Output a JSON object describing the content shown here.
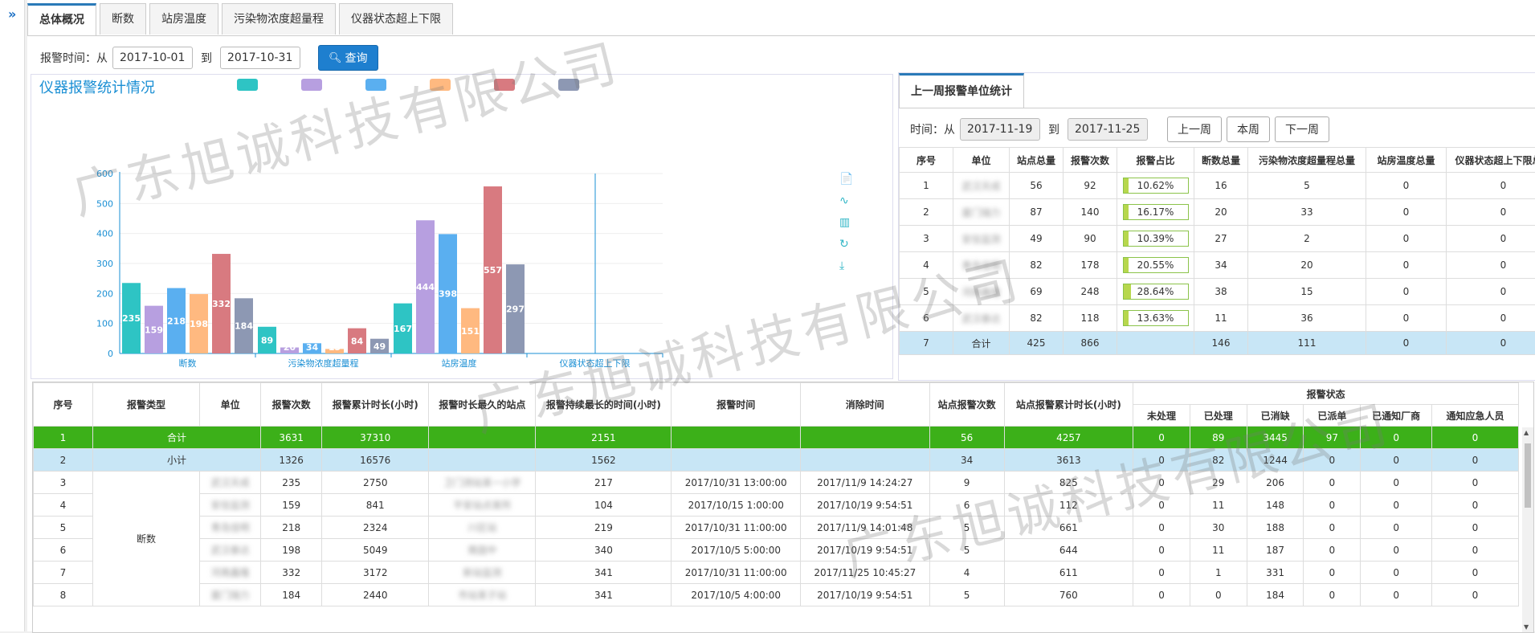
{
  "tabs": [
    "总体概况",
    "断数",
    "站房温度",
    "污染物浓度超量程",
    "仪器状态超上下限"
  ],
  "filter": {
    "label": "报警时间：从",
    "from": "2017-10-01",
    "to_label": "到",
    "to": "2017-10-31",
    "query_label": "查询"
  },
  "chart": {
    "title": "仪器报警统计情况",
    "legend_colors": [
      "#2ec4c4",
      "#b79fe0",
      "#5aaff0",
      "#ffb980",
      "#d87a80",
      "#8d98b3"
    ]
  },
  "chart_data": {
    "type": "bar",
    "categories": [
      "断数",
      "污染物浓度超量程",
      "站房温度",
      "仪器状态超上下限"
    ],
    "ylim": [
      0,
      600
    ],
    "yticks": [
      0,
      100,
      200,
      300,
      400,
      500,
      600
    ],
    "series": [
      {
        "values": [
          235,
          89,
          167,
          0
        ],
        "color": "#2ec4c4"
      },
      {
        "values": [
          159,
          20,
          444,
          0
        ],
        "color": "#b79fe0"
      },
      {
        "values": [
          218,
          34,
          398,
          0
        ],
        "color": "#5aaff0"
      },
      {
        "values": [
          198,
          15,
          151,
          0
        ],
        "color": "#ffb980"
      },
      {
        "values": [
          332,
          84,
          557,
          0
        ],
        "color": "#d87a80"
      },
      {
        "values": [
          184,
          49,
          297,
          0
        ],
        "color": "#8d98b3"
      }
    ],
    "grid": true
  },
  "toolbox": [
    "📄",
    "∿",
    "▥",
    "↻",
    "⤓"
  ],
  "week": {
    "tab": "上一周报警单位统计",
    "time_label": "时间：从",
    "from": "2017-11-19",
    "to_label": "到",
    "to": "2017-11-25",
    "buttons": [
      "上一周",
      "本周",
      "下一周"
    ],
    "headers": [
      "序号",
      "单位",
      "站点总量",
      "报警次数",
      "报警占比",
      "断数总量",
      "污染物浓度超量程总量",
      "站房温度总量",
      "仪器状态超上下限总量"
    ],
    "rows": [
      {
        "no": "1",
        "unit": "武汉天成",
        "sites": "56",
        "alarms": "92",
        "pct": "10.62%",
        "pct_v": 10.62,
        "cut": "16",
        "pollut": "5",
        "temp": "0",
        "inst": "0"
      },
      {
        "no": "2",
        "unit": "厦门瑞力",
        "sites": "87",
        "alarms": "140",
        "pct": "16.17%",
        "pct_v": 16.17,
        "cut": "20",
        "pollut": "33",
        "temp": "0",
        "inst": "0"
      },
      {
        "no": "3",
        "unit": "安信监测",
        "sites": "49",
        "alarms": "90",
        "pct": "10.39%",
        "pct_v": 10.39,
        "cut": "27",
        "pollut": "2",
        "temp": "0",
        "inst": "0"
      },
      {
        "no": "4",
        "unit": "青岛佳明",
        "sites": "82",
        "alarms": "178",
        "pct": "20.55%",
        "pct_v": 20.55,
        "cut": "34",
        "pollut": "20",
        "temp": "0",
        "inst": "0"
      },
      {
        "no": "5",
        "unit": "河南鑫隆",
        "sites": "69",
        "alarms": "248",
        "pct": "28.64%",
        "pct_v": 28.64,
        "cut": "38",
        "pollut": "15",
        "temp": "0",
        "inst": "0"
      },
      {
        "no": "6",
        "unit": "武汉泰达",
        "sites": "82",
        "alarms": "118",
        "pct": "13.63%",
        "pct_v": 13.63,
        "cut": "11",
        "pollut": "36",
        "temp": "0",
        "inst": "0"
      }
    ],
    "total": {
      "no": "7",
      "unit": "合计",
      "sites": "425",
      "alarms": "866",
      "pct": "",
      "cut": "146",
      "pollut": "111",
      "temp": "0",
      "inst": "0"
    }
  },
  "main": {
    "headers": [
      "序号",
      "报警类型",
      "单位",
      "报警次数",
      "报警累计时长(小时)",
      "报警时长最久的站点",
      "报警持续最长的时间(小时)",
      "报警时间",
      "消除时间",
      "站点报警次数",
      "站点报警累计时长(小时)",
      "报警状态"
    ],
    "status_headers": [
      "未处理",
      "已处理",
      "已消缺",
      "已派单",
      "已通知厂商",
      "通知应急人员"
    ],
    "total": {
      "no": "1",
      "type": "合计",
      "count": "3631",
      "hours": "37310",
      "longest": "2151",
      "site_count": "56",
      "site_hours": "4257",
      "s1": "0",
      "s2": "89",
      "s3": "3445",
      "s4": "97",
      "s5": "0",
      "s6": "0"
    },
    "sub": {
      "no": "2",
      "type": "小计",
      "count": "1326",
      "hours": "16576",
      "longest": "1562",
      "site_count": "34",
      "site_hours": "3613",
      "s1": "0",
      "s2": "82",
      "s3": "1244",
      "s4": "0",
      "s5": "0",
      "s6": "0"
    },
    "group_type": "断数",
    "rows": [
      {
        "no": "3",
        "unit": "武汉天成",
        "count": "235",
        "hours": "2750",
        "site": "卫门测站某一小学",
        "longest": "217",
        "alarm_time": "2017/10/31 13:00:00",
        "clear_time": "2017/11/9 14:24:27",
        "site_count": "9",
        "site_hours": "825",
        "s1": "0",
        "s2": "29",
        "s3": "206",
        "s4": "0",
        "s5": "0",
        "s6": "0"
      },
      {
        "no": "4",
        "unit": "安信监测",
        "count": "159",
        "hours": "841",
        "site": "平安站点某所",
        "longest": "104",
        "alarm_time": "2017/10/15 1:00:00",
        "clear_time": "2017/10/19 9:54:51",
        "site_count": "6",
        "site_hours": "112",
        "s1": "0",
        "s2": "11",
        "s3": "148",
        "s4": "0",
        "s5": "0",
        "s6": "0"
      },
      {
        "no": "5",
        "unit": "青岛佳明",
        "count": "218",
        "hours": "2324",
        "site": "川区站",
        "longest": "219",
        "alarm_time": "2017/10/31 11:00:00",
        "clear_time": "2017/11/9 14:01:48",
        "site_count": "5",
        "site_hours": "661",
        "s1": "0",
        "s2": "30",
        "s3": "188",
        "s4": "0",
        "s5": "0",
        "s6": "0"
      },
      {
        "no": "6",
        "unit": "武汉泰达",
        "count": "198",
        "hours": "5049",
        "site": "南固中",
        "longest": "340",
        "alarm_time": "2017/10/5 5:00:00",
        "clear_time": "2017/10/19 9:54:51",
        "site_count": "5",
        "site_hours": "644",
        "s1": "0",
        "s2": "11",
        "s3": "187",
        "s4": "0",
        "s5": "0",
        "s6": "0"
      },
      {
        "no": "7",
        "unit": "河南鑫隆",
        "count": "332",
        "hours": "3172",
        "site": "新站监测",
        "longest": "341",
        "alarm_time": "2017/10/31 11:00:00",
        "clear_time": "2017/11/25 10:45:27",
        "site_count": "4",
        "site_hours": "611",
        "s1": "0",
        "s2": "1",
        "s3": "331",
        "s4": "0",
        "s5": "0",
        "s6": "0"
      },
      {
        "no": "8",
        "unit": "厦门瑞力",
        "count": "184",
        "hours": "2440",
        "site": "市站某子站",
        "longest": "341",
        "alarm_time": "2017/10/5 4:00:00",
        "clear_time": "2017/10/19 9:54:51",
        "site_count": "5",
        "site_hours": "760",
        "s1": "0",
        "s2": "0",
        "s3": "184",
        "s4": "0",
        "s5": "0",
        "s6": "0"
      }
    ]
  },
  "watermark": "广东旭诚科技有限公司"
}
